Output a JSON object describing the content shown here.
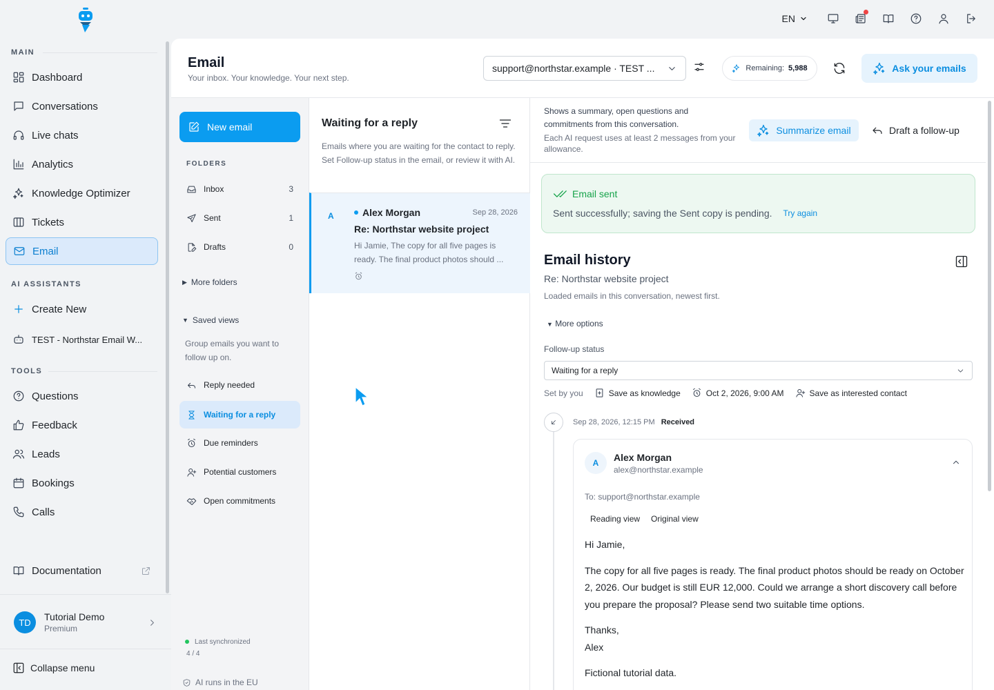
{
  "topbar": {
    "language": "EN",
    "icons": [
      "monitor-icon",
      "news-icon",
      "book-icon",
      "help-icon",
      "user-icon",
      "logout-icon"
    ]
  },
  "sidebar": {
    "section_main": "MAIN",
    "section_ai": "AI ASSISTANTS",
    "section_tools": "TOOLS",
    "main_items": [
      {
        "label": "Dashboard",
        "icon": "dashboard-icon"
      },
      {
        "label": "Conversations",
        "icon": "chat-icon"
      },
      {
        "label": "Live chats",
        "icon": "headset-icon"
      },
      {
        "label": "Analytics",
        "icon": "bar-chart-icon"
      },
      {
        "label": "Knowledge Optimizer",
        "icon": "sparkle-icon"
      },
      {
        "label": "Tickets",
        "icon": "columns-icon"
      },
      {
        "label": "Email",
        "icon": "mail-icon",
        "active": true
      }
    ],
    "ai_items": [
      {
        "label": "Create New",
        "icon": "plus-icon"
      },
      {
        "label": "TEST - Northstar Email W...",
        "icon": "robot-icon"
      }
    ],
    "tool_items": [
      {
        "label": "Questions",
        "icon": "question-icon"
      },
      {
        "label": "Feedback",
        "icon": "thumbs-up-icon"
      },
      {
        "label": "Leads",
        "icon": "users-icon"
      },
      {
        "label": "Bookings",
        "icon": "calendar-icon"
      },
      {
        "label": "Calls",
        "icon": "phone-icon"
      }
    ],
    "documentation": "Documentation",
    "user": {
      "initials": "TD",
      "name": "Tutorial Demo",
      "plan": "Premium"
    },
    "collapse": "Collapse menu"
  },
  "header": {
    "title": "Email",
    "subtitle": "Your inbox. Your knowledge. Your next step.",
    "account": "support@northstar.example · TEST ...",
    "remaining_label": "Remaining:",
    "remaining_value": "5,988",
    "ask_button": "Ask your emails"
  },
  "folders": {
    "new_email": "New email",
    "label": "FOLDERS",
    "items": [
      {
        "label": "Inbox",
        "count": "3"
      },
      {
        "label": "Sent",
        "count": "1"
      },
      {
        "label": "Drafts",
        "count": "0"
      }
    ],
    "more_folders": "More folders",
    "saved_views": "Saved views",
    "saved_desc": "Group emails you want to follow up on.",
    "views": [
      {
        "label": "Reply needed"
      },
      {
        "label": "Waiting for a reply",
        "active": true
      },
      {
        "label": "Due reminders"
      },
      {
        "label": "Potential customers"
      },
      {
        "label": "Open commitments"
      }
    ],
    "sync_label": "Last synchronized",
    "sync_value": "4 / 4",
    "eu_note": "AI runs in the EU"
  },
  "list": {
    "title": "Waiting for a reply",
    "description": "Emails where you are waiting for the contact to reply. Set Follow-up status in the email, or review it with AI.",
    "mail": {
      "avatar": "A",
      "from": "Alex Morgan",
      "date": "Sep 28, 2026",
      "subject": "Re: Northstar website project",
      "preview": "Hi Jamie, The copy for all five pages is ready. The final product photos should ..."
    }
  },
  "detail": {
    "ai_text": "Shows a summary, open questions and commitments from this conversation.",
    "ai_note": "Each AI request uses at least 2 messages from your allowance.",
    "summarize": "Summarize email",
    "draft_follow": "Draft a follow-up",
    "sent_title": "Email sent",
    "sent_msg": "Sent successfully; saving the Sent copy is pending.",
    "try_again": "Try again",
    "history_title": "Email history",
    "history_subject": "Re: Northstar website project",
    "history_note": "Loaded emails in this conversation, newest first.",
    "more_options": "More options",
    "followup_label": "Follow-up status",
    "followup_value": "Waiting for a reply",
    "set_by": "Set by you",
    "save_knowledge": "Save as knowledge",
    "reminder": "Oct 2, 2026, 9:00 AM",
    "save_contact": "Save as interested contact",
    "timeline_date": "Sep 28, 2026, 12:15 PM",
    "timeline_status": "Received",
    "message": {
      "avatar": "A",
      "name": "Alex Morgan",
      "email": "alex@northstar.example",
      "to": "To: support@northstar.example",
      "tab_reading": "Reading view",
      "tab_original": "Original view",
      "greeting": "Hi Jamie,",
      "body": "The copy for all five pages is ready. The final product photos should be ready on October 2, 2026. Our budget is still EUR 12,000. Could we arrange a short discovery call before you prepare the proposal? Please send two suitable time options.",
      "thanks": "Thanks,",
      "signature": "Alex",
      "footer": "Fictional tutorial data."
    }
  },
  "colors": {
    "accent": "#0b9cf0",
    "success": "#16a34a",
    "alert": "#ef4444"
  }
}
